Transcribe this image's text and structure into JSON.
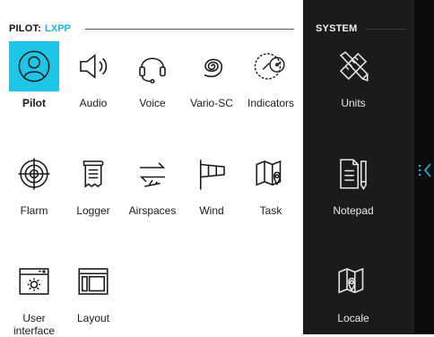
{
  "pilot": {
    "prefix": "PILOT:",
    "profile": "LXPP",
    "tiles": [
      {
        "label": "Pilot",
        "icon": "user-icon",
        "selected": true
      },
      {
        "label": "Audio",
        "icon": "speaker-icon"
      },
      {
        "label": "Voice",
        "icon": "headset-icon"
      },
      {
        "label": "Vario-SC",
        "icon": "spiral-icon"
      },
      {
        "label": "Indicators",
        "icon": "gauges-icon"
      },
      {
        "label": "Flarm",
        "icon": "radar-target-icon"
      },
      {
        "label": "Logger",
        "icon": "scroll-icon"
      },
      {
        "label": "Airspaces",
        "icon": "airspace-swap-icon"
      },
      {
        "label": "Wind",
        "icon": "windsock-icon"
      },
      {
        "label": "Task",
        "icon": "map-pin-icon"
      },
      {
        "label": "User\ninterface",
        "icon": "window-gear-icon"
      },
      {
        "label": "Layout",
        "icon": "layout-icon"
      }
    ]
  },
  "system": {
    "title": "SYSTEM",
    "tiles": [
      {
        "label": "Units",
        "icon": "ruler-pencil-icon"
      },
      {
        "label": "Notepad",
        "icon": "notepad-icon"
      },
      {
        "label": "Locale",
        "icon": "map-pin-icon"
      }
    ]
  },
  "colors": {
    "accent": "#1fc5e6",
    "system_bg": "#1b1b1b",
    "rail_bg": "#0c0c0c"
  }
}
